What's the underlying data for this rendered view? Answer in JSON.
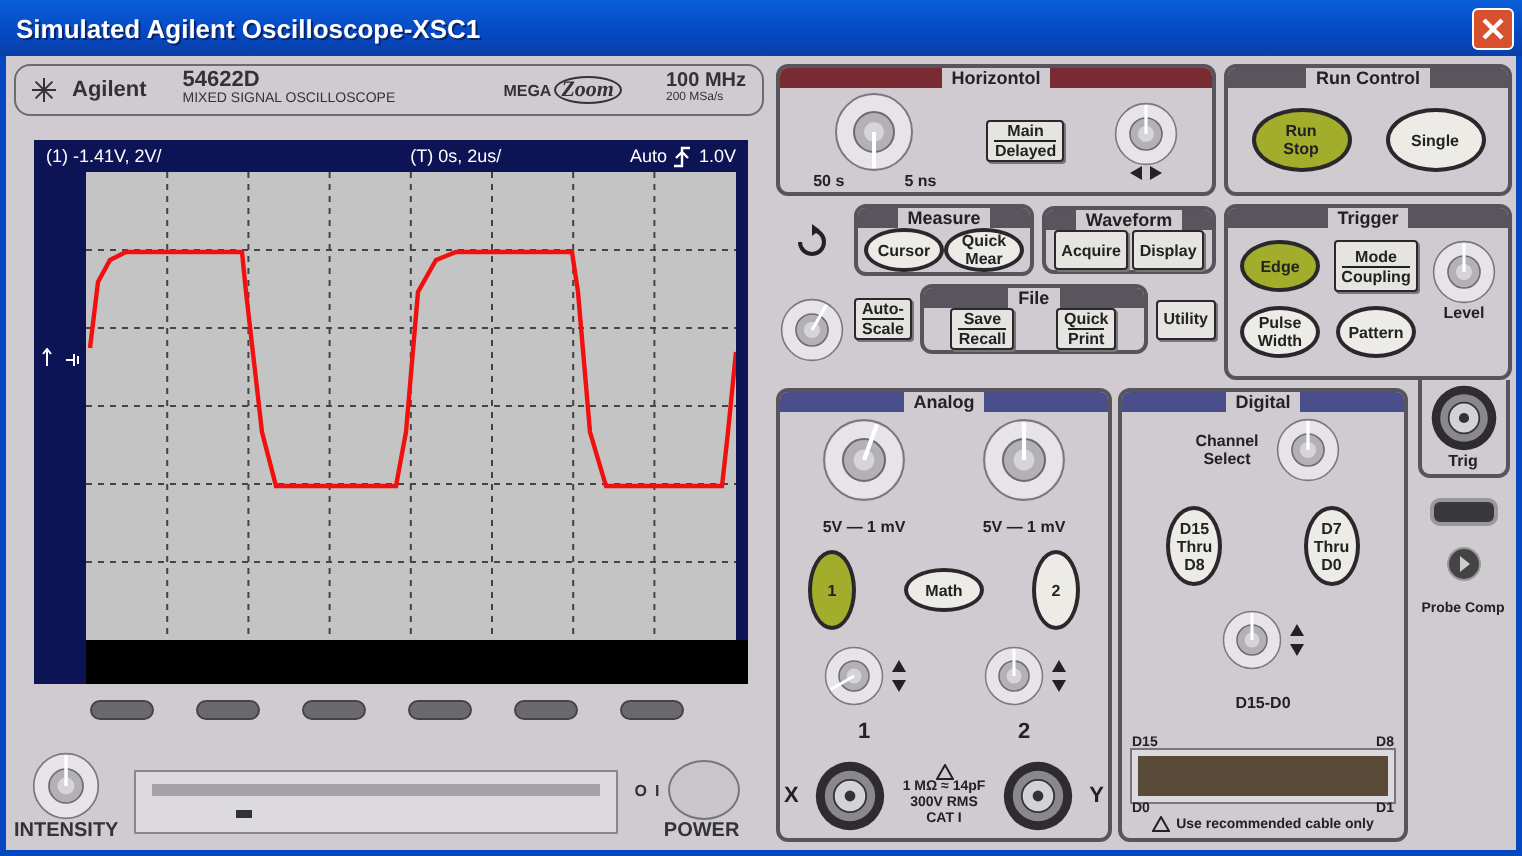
{
  "window": {
    "title": "Simulated Agilent Oscilloscope-XSC1"
  },
  "header": {
    "brand": "Agilent",
    "model": "54622D",
    "description": "MIXED SIGNAL OSCILLOSCOPE",
    "logo_prefix": "MEGA",
    "logo_name": "Zoom",
    "bandwidth": "100 MHz",
    "sample_rate": "200 MSa/s"
  },
  "screen": {
    "channel_readout": "(1) -1.41V, 2V/",
    "time_readout": "(T) 0s, 2us/",
    "trigger_mode": "Auto",
    "trigger_level": "1.0V"
  },
  "front": {
    "intensity_label": "INTENSITY",
    "power_off": "O",
    "power_on": "I",
    "power_label": "POWER"
  },
  "horizontal": {
    "title": "Horizontol",
    "scale_min": "50 s",
    "scale_max": "5 ns",
    "button": {
      "kind": "rect",
      "lit": false,
      "lines": [
        "Main",
        "Delayed"
      ]
    }
  },
  "run_control": {
    "title": "Run Control",
    "buttons": [
      {
        "kind": "oval",
        "lit": true,
        "lines": [
          "Run",
          "Stop"
        ]
      },
      {
        "kind": "oval",
        "lit": false,
        "lines": [
          "Single"
        ]
      }
    ]
  },
  "measure": {
    "title": "Measure",
    "buttons": [
      {
        "kind": "oval",
        "lit": false,
        "lines": [
          "Cursor"
        ]
      },
      {
        "kind": "oval",
        "lit": false,
        "lines": [
          "Quick",
          "Mear"
        ]
      }
    ]
  },
  "waveform": {
    "title": "Waveform",
    "buttons": [
      {
        "kind": "rect",
        "lit": false,
        "lines": [
          "Acquire"
        ]
      },
      {
        "kind": "rect",
        "lit": false,
        "lines": [
          "Display"
        ]
      }
    ]
  },
  "auto_scale": {
    "kind": "rect",
    "lit": false,
    "lines": [
      "Auto-",
      "Scale"
    ]
  },
  "file": {
    "title": "File",
    "buttons": [
      {
        "kind": "rect",
        "lit": false,
        "lines": [
          "Save",
          "Recall"
        ]
      },
      {
        "kind": "rect",
        "lit": false,
        "lines": [
          "Quick",
          "Print"
        ]
      }
    ]
  },
  "utility": {
    "kind": "rect",
    "lit": false,
    "lines": [
      "Utility"
    ]
  },
  "trigger": {
    "title": "Trigger",
    "buttons": [
      {
        "kind": "oval",
        "lit": true,
        "lines": [
          "Edge"
        ]
      },
      {
        "kind": "rect",
        "lit": false,
        "lines": [
          "Mode",
          "Coupling"
        ]
      },
      {
        "kind": "oval",
        "lit": false,
        "lines": [
          "Pulse",
          "Width"
        ]
      },
      {
        "kind": "oval",
        "lit": false,
        "lines": [
          "Pattern"
        ]
      }
    ],
    "level_label": "Level",
    "input_label": "Trig"
  },
  "analog": {
    "title": "Analog",
    "channels": [
      {
        "range": "5V — 1 mV",
        "button": {
          "kind": "oval",
          "lit": true,
          "lines": [
            "1"
          ]
        },
        "input_number": "1",
        "axis": "X"
      },
      {
        "range": "5V — 1 mV",
        "button": {
          "kind": "oval",
          "lit": false,
          "lines": [
            "2"
          ]
        },
        "input_number": "2",
        "axis": "Y"
      }
    ],
    "math_button": {
      "kind": "oval",
      "lit": false,
      "lines": [
        "Math"
      ]
    },
    "warning": "1 MΩ ≈ 14pF 300V RMS CAT I"
  },
  "digital": {
    "title": "Digital",
    "select_label": "Channel Select",
    "buttons": [
      {
        "kind": "oval",
        "lit": false,
        "lines": [
          "D15",
          "Thru",
          "D8"
        ]
      },
      {
        "kind": "oval",
        "lit": false,
        "lines": [
          "D7",
          "Thru",
          "D0"
        ]
      }
    ],
    "position_label": "D15-D0",
    "pin_top_left": "D15",
    "pin_top_right": "D8",
    "pin_bottom_left": "D0",
    "pin_bottom_right": "D1",
    "notice": "Use recommended cable only"
  },
  "probe_comp": "Probe Comp"
}
